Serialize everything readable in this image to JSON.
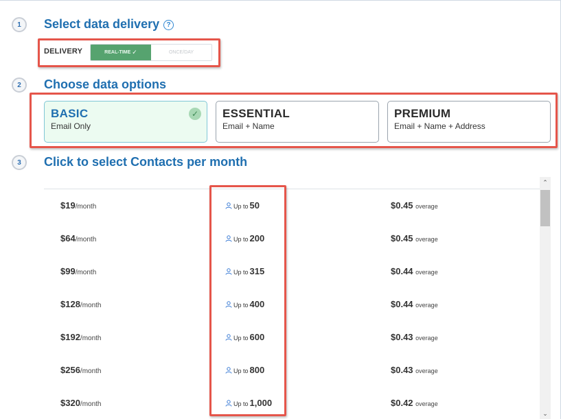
{
  "steps": [
    {
      "number": "1",
      "title": "Select data delivery"
    },
    {
      "number": "2",
      "title": "Choose data options"
    },
    {
      "number": "3",
      "title": "Click to select Contacts per month"
    }
  ],
  "delivery": {
    "label": "DELIVERY",
    "options": [
      {
        "label": "REAL-TIME",
        "selected": true
      },
      {
        "label": "ONCE/DAY",
        "selected": false
      }
    ]
  },
  "data_options": [
    {
      "name": "BASIC",
      "description": "Email Only",
      "selected": true
    },
    {
      "name": "ESSENTIAL",
      "description": "Email + Name",
      "selected": false
    },
    {
      "name": "PREMIUM",
      "description": "Email + Name + Address",
      "selected": false
    }
  ],
  "plans": {
    "per_label": "/month",
    "upto_label": "Up to",
    "overage_label": "overage",
    "rows": [
      {
        "price": "$19",
        "contacts": "50",
        "overage": "$0.45"
      },
      {
        "price": "$64",
        "contacts": "200",
        "overage": "$0.45"
      },
      {
        "price": "$99",
        "contacts": "315",
        "overage": "$0.44"
      },
      {
        "price": "$128",
        "contacts": "400",
        "overage": "$0.44"
      },
      {
        "price": "$192",
        "contacts": "600",
        "overage": "$0.43"
      },
      {
        "price": "$256",
        "contacts": "800",
        "overage": "$0.43"
      },
      {
        "price": "$320",
        "contacts": "1,000",
        "overage": "$0.42"
      }
    ]
  },
  "icons": {
    "help": "question-circle-icon",
    "check": "check-icon",
    "user": "user-icon",
    "scroll_up": "chevron-up-icon",
    "scroll_down": "chevron-down-icon"
  },
  "colors": {
    "accent_blue": "#1f6fb0",
    "toggle_green": "#56a36f",
    "selected_card_bg": "#ecfbf1",
    "annotation_red": "#e5554a"
  }
}
